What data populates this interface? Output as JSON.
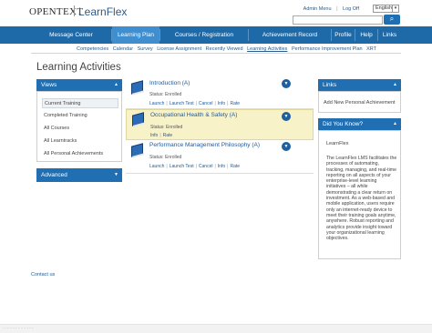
{
  "header": {
    "logo": "OPENTEXT",
    "product": "LearnFlex",
    "links": [
      "Admin Menu",
      "Log Off"
    ],
    "language": "English"
  },
  "nav": [
    "Message Center",
    "Learning Plan",
    "Courses / Registration",
    "Achievement Record",
    "Profile",
    "Help",
    "Links"
  ],
  "subnav": [
    "Competencies",
    "Calendar",
    "Survey",
    "License Assignment",
    "Recently Viewed",
    "Learning Activities",
    "Performance Improvement Plan",
    "XRT"
  ],
  "page_title": "Learning Activities",
  "views": {
    "title": "Views",
    "items": [
      "Current Training",
      "Completed Training",
      "All Courses",
      "All Learntracks",
      "All Personal Achievements"
    ]
  },
  "advanced": {
    "title": "Advanced"
  },
  "activities": [
    {
      "title": "Introduction (A)",
      "status": "Status: Enrolled",
      "links": [
        "Launch",
        "Launch Test",
        "Cancel",
        "Info",
        "Rate"
      ]
    },
    {
      "title": "Occupational Health & Safety (A)",
      "status": "Status: Enrolled",
      "links": [
        "Info",
        "Rate"
      ]
    },
    {
      "title": "Performance Management Philosophy (A)",
      "status": "Status: Enrolled",
      "links": [
        "Launch",
        "Launch Test",
        "Cancel",
        "Info",
        "Rate"
      ]
    }
  ],
  "links_panel": {
    "title": "Links",
    "item": "Add New Personal Achievement"
  },
  "dyk": {
    "title": "Did You Know?",
    "heading": "LearnFlex",
    "text": "The LearnFlex LMS facilitates the processes of automating, tracking, managing, and real-time reporting on all aspects of your enterprise-level learning initiatives – all while demonstrating a clear return on investment. As a web-based and mobile application, users require only an internet-ready device to meet their training goals anytime, anywhere. Robust reporting and analytics provide insight toward your organizational learning objectives."
  },
  "footer": {
    "contact": "Contact us"
  }
}
